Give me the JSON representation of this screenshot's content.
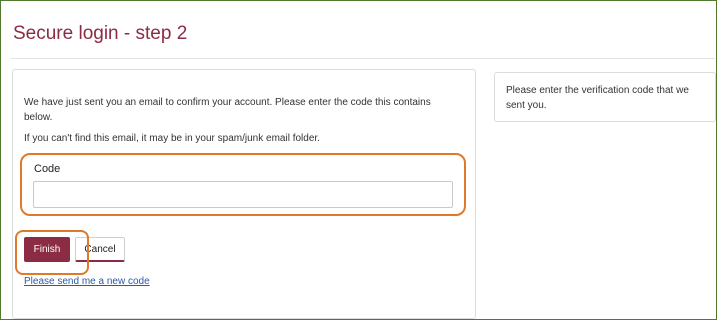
{
  "page": {
    "title": "Secure login - step 2"
  },
  "main": {
    "intro_text": "We have just sent you an email to confirm your account. Please enter the code this contains below.",
    "spam_note": "If you can't find this email, it may be in your spam/junk email folder.",
    "code_label": "Code",
    "code_value": "",
    "finish_label": "Finish",
    "cancel_label": "Cancel",
    "new_code_link": "Please send me a new code"
  },
  "sidebar": {
    "help_text": "Please enter the verification code that we sent you."
  },
  "colors": {
    "brand": "#8c2b44",
    "highlight": "#e07a29",
    "link": "#2a5aa8",
    "frame": "#4f7a2e"
  }
}
